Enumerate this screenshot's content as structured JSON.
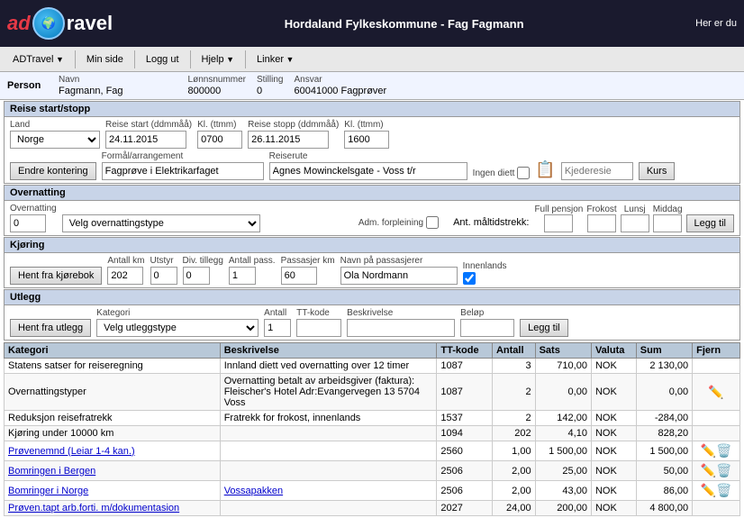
{
  "header": {
    "title": "Hordaland Fylkeskommune - Fag Fagmann",
    "right_text": "Her er du",
    "logo_ad": "ad",
    "logo_ravel": "ravel"
  },
  "nav": {
    "items": [
      {
        "label": "ADTravel",
        "arrow": true
      },
      {
        "label": "Min side",
        "arrow": false
      },
      {
        "label": "Logg ut",
        "arrow": false
      },
      {
        "label": "Hjelp",
        "arrow": true
      },
      {
        "label": "Linker",
        "arrow": true
      }
    ]
  },
  "person": {
    "section_label": "Person",
    "navn_label": "Navn",
    "navn_value": "Fagmann, Fag",
    "lonnsnummer_label": "Lønnsnummer",
    "lonnsnummer_value": "800000",
    "stilling_label": "Stilling",
    "stilling_value": "0",
    "ansvar_label": "Ansvar",
    "ansvar_value": "60041000 Fagprøver"
  },
  "reise": {
    "section_label": "Reise start/stopp",
    "land_label": "Land",
    "land_value": "Norge",
    "reise_start_label": "Reise start (ddmmåå)",
    "reise_start_value": "24.11.2015",
    "kl_start_label": "Kl. (ttmm)",
    "kl_start_value": "0700",
    "reise_stopp_label": "Reise stopp (ddmmåå)",
    "reise_stopp_value": "26.11.2015",
    "kl_stopp_label": "Kl. (ttmm)",
    "kl_stopp_value": "1600",
    "formal_label": "Formål/arrangement",
    "formal_value": "Fagprøve i Elektrikarfaget",
    "reiserute_label": "Reiserute",
    "reiserute_value": "Agnes Mowinckelsgate - Voss t/r",
    "ingen_diett_label": "Ingen diett",
    "kjederesie_label": "Kjederesie",
    "kurs_label": "Kurs",
    "endre_kontering_label": "Endre kontering"
  },
  "overnatting": {
    "section_label": "Overnatting",
    "overnatting_label": "Overnatting",
    "overnatting_value": "0",
    "velg_type_label": "Velg overnattingstype",
    "adm_forpleining_label": "Adm. forpleining",
    "ant_maltidstrekk_label": "Ant. måltidstrekk:",
    "full_pensjon_label": "Full pensjon",
    "frokost_label": "Frokost",
    "lunsj_label": "Lunsj",
    "middag_label": "Middag",
    "legg_til_label": "Legg til"
  },
  "kjoring": {
    "section_label": "Kjøring",
    "hent_fra_label": "Hent fra kjørebok",
    "antall_km_label": "Antall km",
    "antall_km_value": "202",
    "utstyr_label": "Utstyr",
    "utstyr_value": "0",
    "div_tillegg_label": "Div. tillegg",
    "div_tillegg_value": "0",
    "antall_pass_label": "Antall pass.",
    "antall_pass_value": "1",
    "passasjer_km_label": "Passasjer km",
    "passasjer_km_value": "60",
    "navn_passasjerer_label": "Navn på passasjerer",
    "navn_passasjerer_value": "Ola Nordmann",
    "innenlands_label": "Innenlands"
  },
  "utlegg": {
    "section_label": "Utlegg",
    "hent_fra_label": "Hent fra utlegg",
    "kategori_label": "Kategori",
    "velg_type_label": "Velg utleggstype",
    "antall_label": "Antall",
    "antall_value": "1",
    "tt_kode_label": "TT-kode",
    "beskrivelse_label": "Beskrivelse",
    "belop_label": "Beløp",
    "legg_til_label": "Legg til"
  },
  "table": {
    "headers": [
      "Kategori",
      "Beskrivelse",
      "TT-kode",
      "Antall",
      "Sats",
      "Valuta",
      "Sum",
      "Fjern"
    ],
    "rows": [
      {
        "kategori": "Statens satser for reiseregning",
        "beskrivelse": "Innland diett ved overnatting over 12 timer",
        "tt_kode": "1087",
        "antall": "3",
        "sats": "710,00",
        "valuta": "NOK",
        "sum": "2 130,00",
        "has_edit": false,
        "has_del": false,
        "kategori_link": false,
        "besk_link": false
      },
      {
        "kategori": "Overnattingstyper",
        "beskrivelse": "Overnatting betalt av arbeidsgiver (faktura): Fleischer's Hotel Adr:Evangervegen 13 5704 Voss",
        "tt_kode": "1087",
        "antall": "2",
        "sats": "0,00",
        "valuta": "NOK",
        "sum": "0,00",
        "has_edit": true,
        "has_del": false,
        "kategori_link": false,
        "besk_link": false
      },
      {
        "kategori": "Reduksjon reisefratrekk",
        "beskrivelse": "Fratrekk for frokost, innenlands",
        "tt_kode": "1537",
        "antall": "2",
        "sats": "142,00",
        "valuta": "NOK",
        "sum": "-284,00",
        "has_edit": false,
        "has_del": false,
        "kategori_link": false,
        "besk_link": false
      },
      {
        "kategori": "Kjøring under 10000 km",
        "beskrivelse": "",
        "tt_kode": "1094",
        "antall": "202",
        "sats": "4,10",
        "valuta": "NOK",
        "sum": "828,20",
        "has_edit": false,
        "has_del": false,
        "kategori_link": false,
        "besk_link": false
      },
      {
        "kategori": "Prøvenemnd (Leiar 1-4 kan.)",
        "beskrivelse": "",
        "tt_kode": "2560",
        "antall": "1,00",
        "sats": "1 500,00",
        "valuta": "NOK",
        "sum": "1 500,00",
        "has_edit": true,
        "has_del": true,
        "kategori_link": true,
        "besk_link": false
      },
      {
        "kategori": "Bomringen i Bergen",
        "beskrivelse": "",
        "tt_kode": "2506",
        "antall": "2,00",
        "sats": "25,00",
        "valuta": "NOK",
        "sum": "50,00",
        "has_edit": true,
        "has_del": true,
        "kategori_link": true,
        "besk_link": false
      },
      {
        "kategori": "Bomringer i Norge",
        "beskrivelse": "Vossapakken",
        "tt_kode": "2506",
        "antall": "2,00",
        "sats": "43,00",
        "valuta": "NOK",
        "sum": "86,00",
        "has_edit": true,
        "has_del": true,
        "kategori_link": true,
        "besk_link": true
      },
      {
        "kategori": "Prøven.tapt arb.forti. m/dokumentasion",
        "beskrivelse": "",
        "tt_kode": "2027",
        "antall": "24,00",
        "sats": "200,00",
        "valuta": "NOK",
        "sum": "4 800,00",
        "has_edit": false,
        "has_del": false,
        "kategori_link": true,
        "besk_link": false
      }
    ]
  }
}
